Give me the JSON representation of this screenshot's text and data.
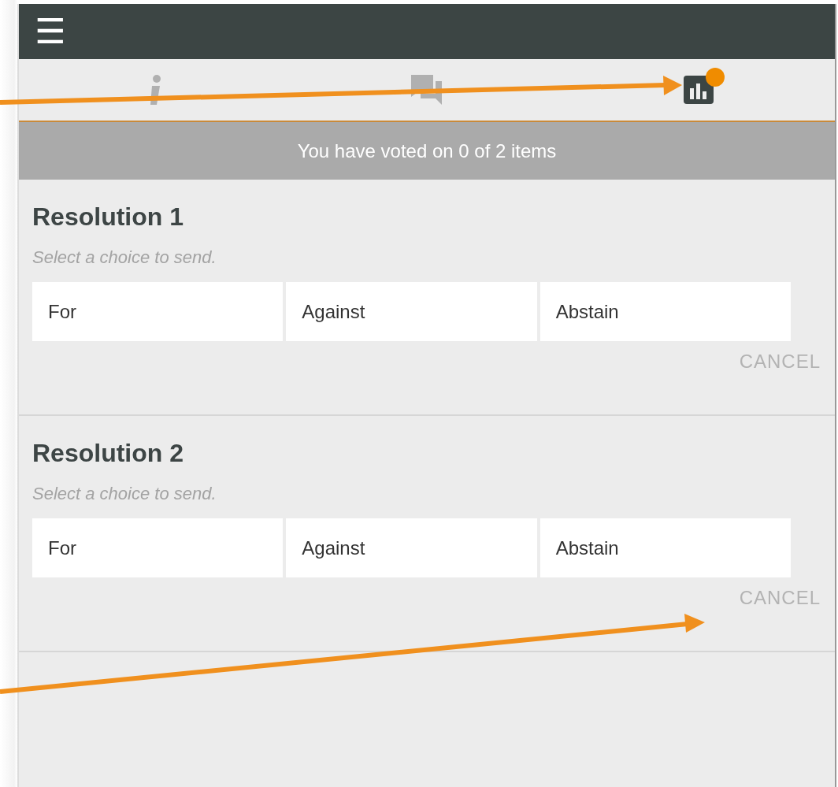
{
  "header": {
    "menu": "☰"
  },
  "tabs": [
    {
      "kind": "info",
      "selected": false,
      "notification": false
    },
    {
      "kind": "chat",
      "selected": false,
      "notification": false
    },
    {
      "kind": "results",
      "selected": true,
      "notification": true
    }
  ],
  "status_bar": "You have voted on 0 of 2 items",
  "items": [
    {
      "title": "Resolution 1",
      "hint": "Select a choice to send.",
      "choices": [
        {
          "label": "For",
          "selected": false
        },
        {
          "label": "Against",
          "selected": false
        },
        {
          "label": "Abstain",
          "selected": false
        }
      ],
      "cancel": "CANCEL"
    },
    {
      "title": "Resolution 2",
      "hint": "Select a choice to send.",
      "choices": [
        {
          "label": "For",
          "selected": false
        },
        {
          "label": "Against",
          "selected": false
        },
        {
          "label": "Abstain",
          "selected": false
        }
      ],
      "cancel": "CANCEL"
    }
  ]
}
